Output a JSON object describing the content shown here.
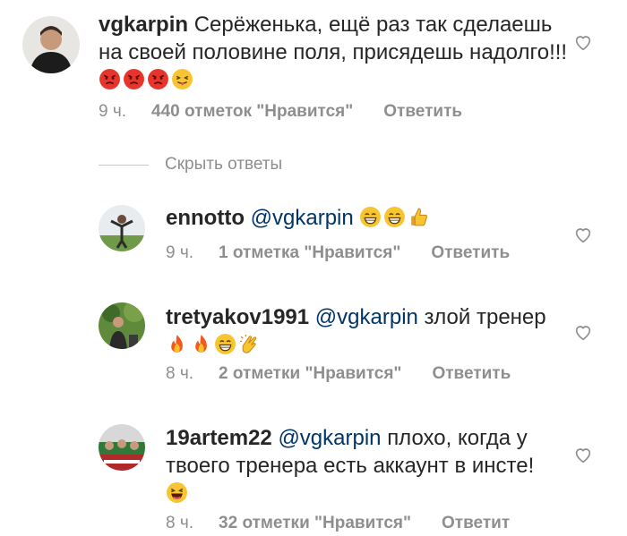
{
  "comments": [
    {
      "username": "vgkarpin",
      "mention": "",
      "text": "Серёженька, ещё раз так сделаешь на своей половине поля, присядешь надолго!!!",
      "emojis": [
        "angry-face",
        "angry-face",
        "angry-face",
        "tongue-face"
      ],
      "time": "9 ч.",
      "likes": "440 отметок \"Нравится\"",
      "reply": "Ответить"
    },
    {
      "username": "ennotto",
      "mention": "@vgkarpin",
      "text": "",
      "emojis": [
        "grin-face",
        "grin-face",
        "thumbs-up"
      ],
      "time": "9 ч.",
      "likes": "1 отметка \"Нравится\"",
      "reply": "Ответить"
    },
    {
      "username": "tretyakov1991",
      "mention": "@vgkarpin",
      "text": "злой тренер",
      "emojis": [
        "fire",
        "fire",
        "grin-face",
        "clapping-hands"
      ],
      "time": "8 ч.",
      "likes": "2 отметки \"Нравится\"",
      "reply": "Ответить"
    },
    {
      "username": "19artem22",
      "mention": "@vgkarpin",
      "text": "плохо, когда у твоего тренера есть аккаунт в инсте!",
      "emojis": [
        "laughing-face"
      ],
      "time": "8 ч.",
      "likes": "32 отметки \"Нравится\"",
      "reply": "Ответит"
    }
  ],
  "hide_replies": "Скрыть ответы",
  "colors": {
    "text": "#262626",
    "meta": "#8e8e8e",
    "mention": "#003569",
    "heart": "#8e8e8e"
  }
}
